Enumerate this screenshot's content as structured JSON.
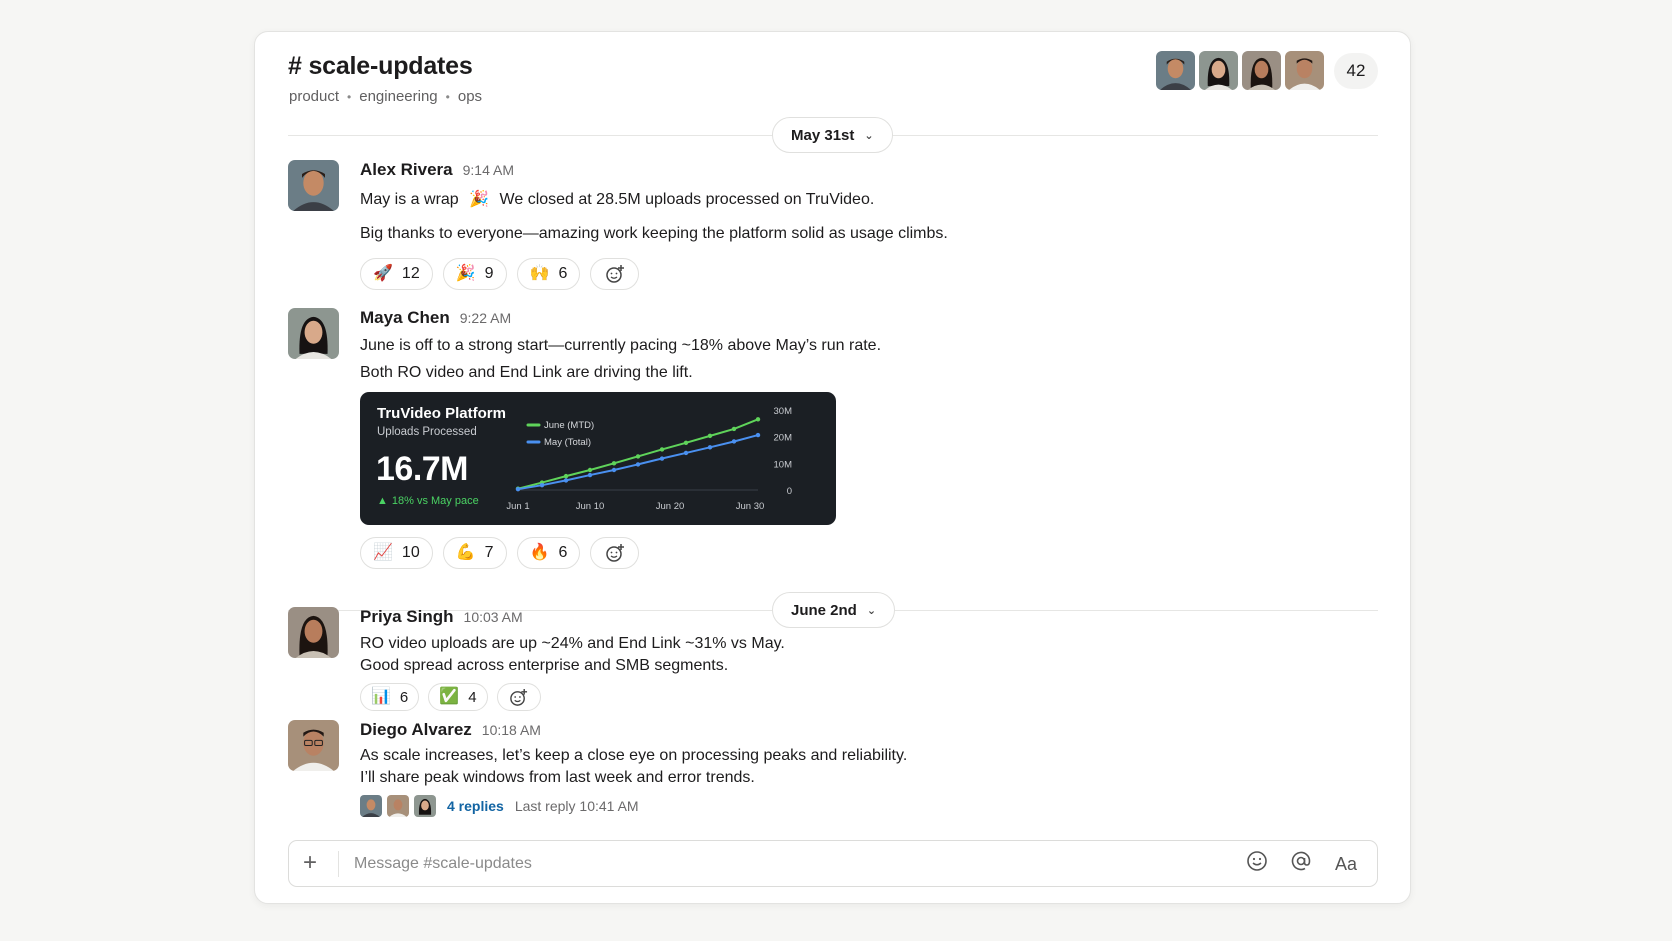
{
  "channel": {
    "title": "# scale-updates",
    "tags": [
      "product",
      "engineering",
      "ops"
    ],
    "member_count": "42"
  },
  "dividers": [
    {
      "label": "May 31st"
    },
    {
      "label": "June 2nd"
    }
  ],
  "messages": [
    {
      "author": "Alex Rivera",
      "time": "9:14 AM",
      "line1_a": "May is a wrap",
      "line1_emoji": "🎉",
      "line1_b": "We closed at 28.5M uploads processed on TruVideo.",
      "line2": "Big thanks to everyone—amazing work keeping the platform solid as usage climbs.",
      "reactions": [
        {
          "emoji": "🚀",
          "count": "12"
        },
        {
          "emoji": "🎉",
          "count": "9"
        },
        {
          "emoji": "🙌",
          "count": "6"
        }
      ]
    },
    {
      "author": "Maya Chen",
      "time": "9:22 AM",
      "line1": "June is off to a strong start—currently pacing ~18% above May’s run rate.",
      "line2": "Both RO video and End Link are driving the lift.",
      "reactions": [
        {
          "emoji": "📈",
          "count": "10"
        },
        {
          "emoji": "💪",
          "count": "7"
        },
        {
          "emoji": "🔥",
          "count": "6"
        }
      ],
      "card": {
        "title": "TruVideo Platform",
        "subtitle": "Uploads Processed",
        "value": "16.7M",
        "delta": "18% vs May pace",
        "delta_icon": "▲"
      }
    },
    {
      "author": "Priya Singh",
      "time": "10:03 AM",
      "line1": "RO video uploads are up ~24% and End Link ~31% vs May.",
      "line2": "Good spread across enterprise and SMB segments.",
      "reactions": [
        {
          "emoji": "📊",
          "count": "6"
        },
        {
          "emoji": "✅",
          "count": "4"
        }
      ]
    },
    {
      "author": "Diego Alvarez",
      "time": "10:18 AM",
      "line1": "As scale increases, let’s keep a close eye on processing peaks and reliability.",
      "line2": "I’ll share peak windows from last week and error trends.",
      "thread": {
        "replies": "4 replies",
        "last_reply": "Last reply 10:41 AM"
      }
    }
  ],
  "composer": {
    "placeholder": "Message #scale-updates",
    "plus_icon": "+",
    "format_label": "Aa"
  },
  "colors": {
    "link": "#1264a3",
    "june_series": "#5fd35a",
    "may_series": "#4a90f0",
    "card_bg": "#1b1f24"
  },
  "chart_data": {
    "type": "line",
    "title": "TruVideo Platform",
    "subtitle": "Uploads Processed",
    "x_ticks": [
      "Jun 1",
      "Jun 10",
      "Jun 20",
      "Jun 30"
    ],
    "y_ticks": [
      "30M",
      "20M",
      "10M",
      "0"
    ],
    "ylim": [
      0,
      30
    ],
    "legend_position": "top-left",
    "series": [
      {
        "name": "June (MTD)",
        "x": [
          1,
          4,
          7,
          10,
          13,
          16,
          19,
          22,
          25,
          28,
          31
        ],
        "values": [
          0.5,
          2.8,
          5.2,
          7.5,
          10.0,
          12.6,
          15.2,
          17.7,
          20.3,
          22.9,
          26.5
        ]
      },
      {
        "name": "May (Total)",
        "x": [
          1,
          4,
          7,
          10,
          13,
          16,
          19,
          22,
          25,
          28,
          31
        ],
        "values": [
          0.3,
          1.8,
          3.6,
          5.6,
          7.5,
          9.6,
          11.8,
          13.9,
          16.0,
          18.2,
          20.6
        ]
      }
    ]
  }
}
